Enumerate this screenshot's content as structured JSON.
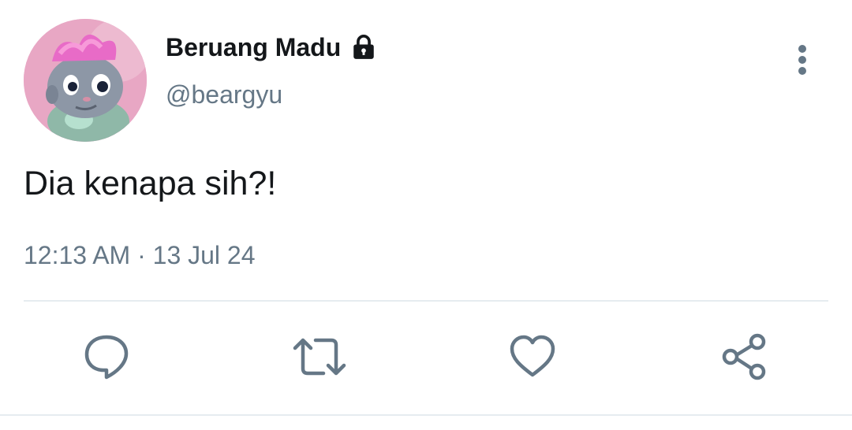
{
  "tweet": {
    "author": {
      "display_name": "Beruang Madu",
      "handle": "@beargyu",
      "protected_icon": "lock-icon",
      "avatar": "avatar-cartoon-cat"
    },
    "text": "Dia kenapa sih?!",
    "time": "12:13 AM",
    "separator": "·",
    "date": "13 Jul 24"
  },
  "header": {
    "more_icon": "more-vertical-icon"
  },
  "actions": [
    {
      "icon": "reply-icon"
    },
    {
      "icon": "retweet-icon"
    },
    {
      "icon": "like-icon"
    },
    {
      "icon": "share-icon"
    }
  ],
  "colors": {
    "text_primary": "#14171a",
    "text_secondary": "#657786",
    "icon": "#657786",
    "divider": "#e6ecf0",
    "avatar_bg": "#e8a7c4"
  }
}
